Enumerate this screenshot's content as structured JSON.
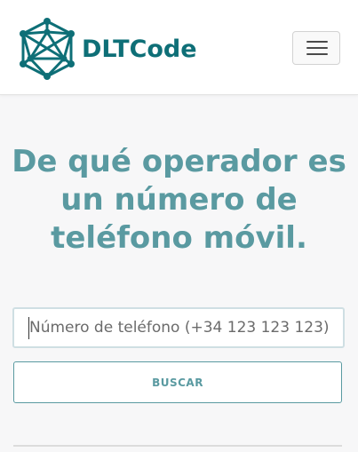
{
  "header": {
    "brand_name": "DLTCode",
    "logo_icon": "network-sphere-icon",
    "menu_icon": "hamburger-menu-icon"
  },
  "main": {
    "heading": "De qué operador es un número de teléfono móvil.",
    "search": {
      "placeholder": "Número de teléfono (+34 123 123 123)",
      "value": ""
    },
    "search_button_label": "BUSCAR"
  },
  "colors": {
    "brand": "#0e6f77",
    "accent": "#5a9aa1",
    "input_border": "#cfdfe3",
    "background": "#f7f7f8"
  }
}
